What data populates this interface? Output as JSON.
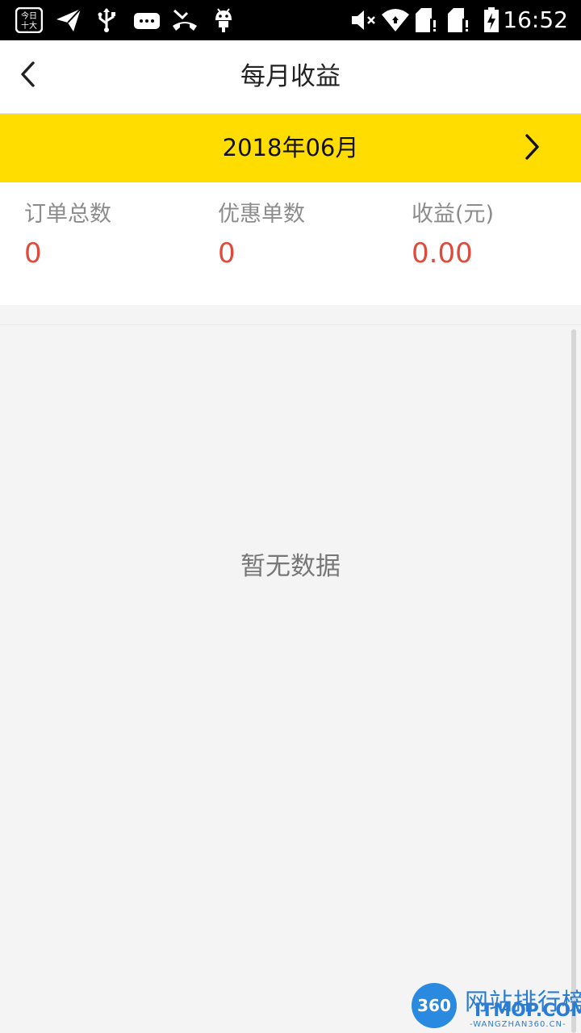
{
  "status_bar": {
    "time": "16:52",
    "icons": [
      "news-app-icon",
      "send-icon",
      "usb-icon",
      "message-icon",
      "missed-call-icon",
      "android-icon",
      "mute-icon",
      "wifi-icon",
      "sim1-icon",
      "sim2-icon",
      "battery-charging-icon"
    ]
  },
  "header": {
    "title": "每月收益",
    "back_icon": "chevron-left-icon"
  },
  "month_selector": {
    "label": "2018年06月",
    "next_icon": "chevron-right-icon",
    "background": "#ffdd00"
  },
  "stats": [
    {
      "label": "订单总数",
      "value": "0"
    },
    {
      "label": "优惠单数",
      "value": "0"
    },
    {
      "label": "收益(元)",
      "value": "0.00"
    }
  ],
  "empty_state": {
    "text": "暂无数据"
  },
  "watermark": {
    "logo_text": "360",
    "cn_text": "网站排行榜",
    "en_text": "ITMOP.COM",
    "sub_text": "-WANGZHAN360.CN-"
  },
  "colors": {
    "accent": "#ffdd00",
    "value_red": "#e04a3a",
    "label_gray": "#8c8c8c"
  }
}
